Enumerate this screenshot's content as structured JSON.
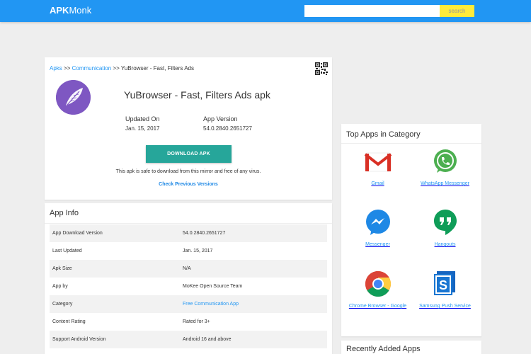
{
  "header": {
    "logo_bold": "APK",
    "logo_light": "Monk",
    "search_placeholder": "",
    "search_button": "search"
  },
  "breadcrumb": {
    "root": "Apks",
    "sep1": ">>",
    "category": "Communication",
    "sep2": ">>",
    "current": "YuBrowser - Fast, Filters Ads"
  },
  "app": {
    "title": "YuBrowser - Fast, Filters Ads apk",
    "updated_label": "Updated On",
    "updated_value": "Jan. 15, 2017",
    "version_label": "App Version",
    "version_value": "54.0.2840.2651727",
    "download_label": "DOWNLOAD APK",
    "safe_text": "This apk is safe to download from this mirror and free of any virus.",
    "check_link": "Check Previous Versions"
  },
  "app_info": {
    "title": "App Info",
    "rows": [
      {
        "key": "App Download Version",
        "value": "54.0.2840.2651727"
      },
      {
        "key": "Last Updated",
        "value": "Jan. 15, 2017"
      },
      {
        "key": "Apk Size",
        "value": "N/A"
      },
      {
        "key": "App by",
        "value": "MoKee Open Source Team"
      },
      {
        "key": "Category",
        "value": "Free Communication App"
      },
      {
        "key": "Content Rating",
        "value": "Rated for 3+"
      },
      {
        "key": "Support Android Version",
        "value": "Android 16 and above"
      }
    ]
  },
  "top_apps": {
    "title": "Top Apps in Category",
    "items": [
      {
        "label": "Gmail",
        "icon": "gmail-icon"
      },
      {
        "label": "WhatsApp Messenger",
        "icon": "whatsapp-icon"
      },
      {
        "label": "Messenger",
        "icon": "messenger-icon"
      },
      {
        "label": "Hangouts",
        "icon": "hangouts-icon"
      },
      {
        "label": "Chrome Browser - Google",
        "icon": "chrome-icon"
      },
      {
        "label": "Samsung Push Service",
        "icon": "samsung-push-icon"
      }
    ]
  },
  "recent": {
    "title": "Recently Added Apps"
  },
  "colors": {
    "topbar": "#2196f3",
    "search_button": "#ffeb3b",
    "download_button": "#26a69a",
    "link": "#2196f3",
    "app_logo": "#7e57c2"
  }
}
